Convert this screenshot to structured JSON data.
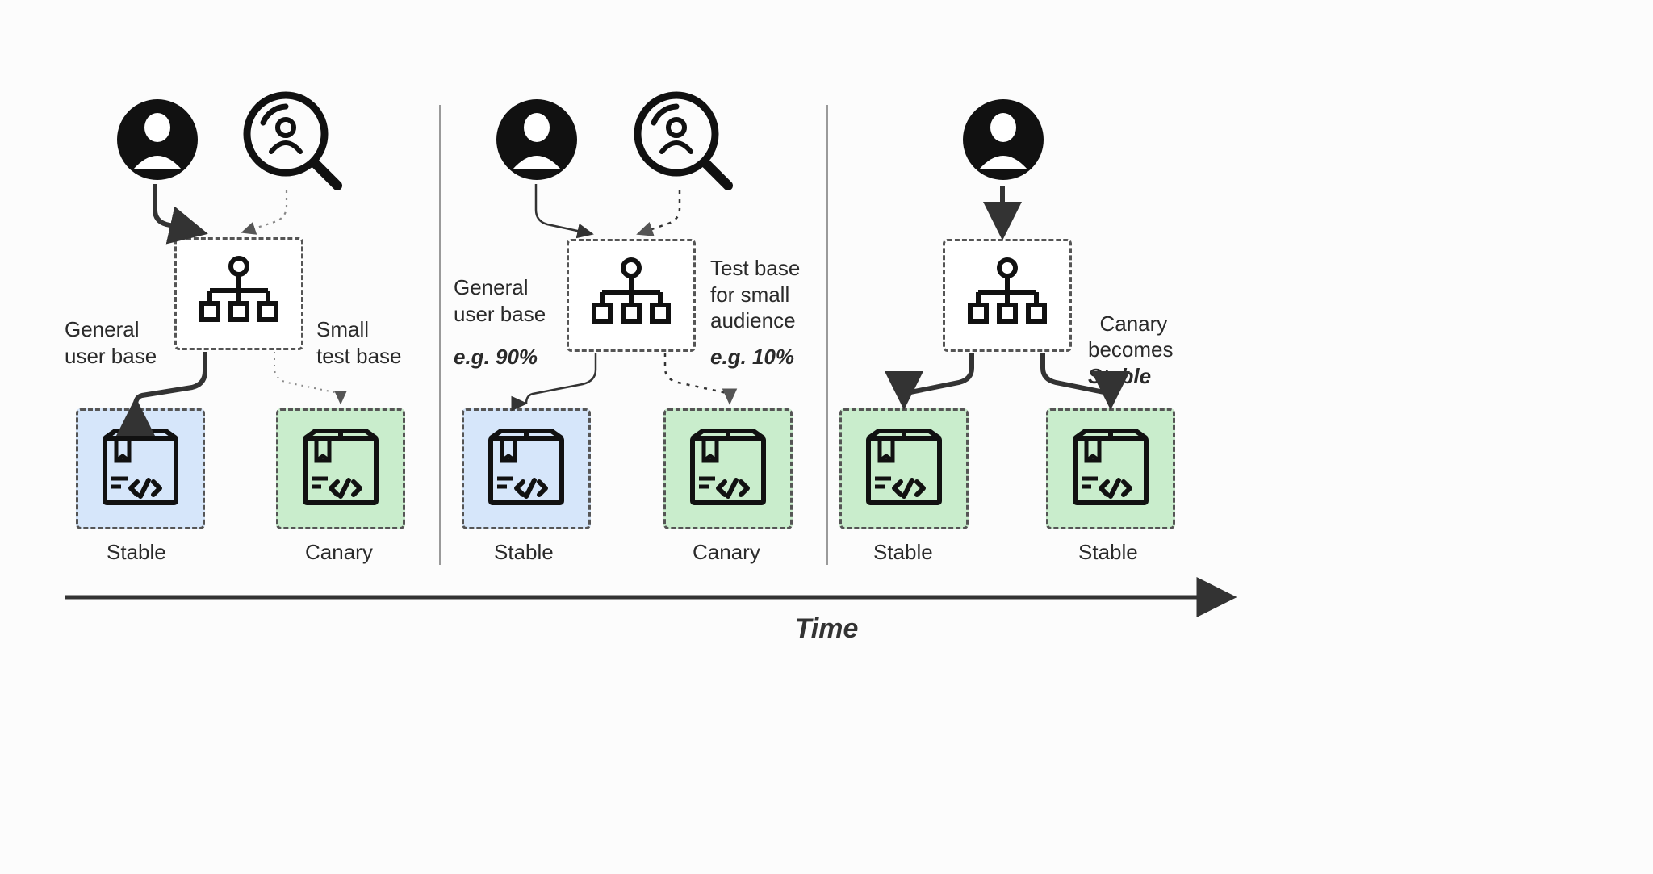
{
  "axis": {
    "label": "Time"
  },
  "phases": [
    {
      "leftLabel": "General\nuser base",
      "rightLabel": "Small\ntest base",
      "leftPkg": "Stable",
      "rightPkg": "Canary",
      "leftPkgColor": "stable",
      "rightPkgColor": "canary",
      "showSearchUser": true
    },
    {
      "leftLabel": "General\nuser base",
      "leftLabelEm": "e.g. 90%",
      "rightLabel": "Test base\nfor small\naudience",
      "rightLabelEm": "e.g. 10%",
      "leftPkg": "Stable",
      "rightPkg": "Canary",
      "leftPkgColor": "stable",
      "rightPkgColor": "canary",
      "showSearchUser": true
    },
    {
      "rightLabel": "Canary\nbecomes\n",
      "rightLabelEm": "Stable",
      "leftPkg": "Stable",
      "rightPkg": "Stable",
      "leftPkgColor": "canary",
      "rightPkgColor": "canary",
      "showSearchUser": false
    }
  ]
}
